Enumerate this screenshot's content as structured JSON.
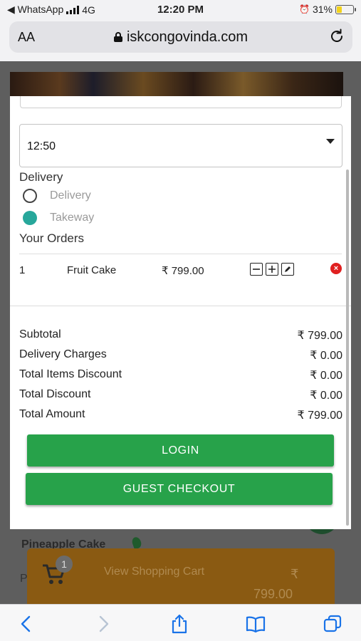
{
  "status_bar": {
    "back_app": "◀ WhatsApp",
    "network": "4G",
    "time": "12:20 PM",
    "battery": "31%",
    "battery_level": 0.31
  },
  "browser": {
    "text_size_label": "AA",
    "url": "iskcongovinda.com"
  },
  "modal": {
    "time_select": {
      "value": "12:50"
    },
    "delivery_section_title": "Delivery",
    "delivery_options": [
      {
        "label": "Delivery",
        "selected": false
      },
      {
        "label": "Takeway",
        "selected": true
      }
    ],
    "orders_title": "Your Orders",
    "orders": [
      {
        "qty": "1",
        "name": "Fruit Cake",
        "price": "₹ 799.00"
      }
    ],
    "summary": [
      {
        "label": "Subtotal",
        "value": "₹ 799.00"
      },
      {
        "label": "Delivery Charges",
        "value": "₹ 0.00"
      },
      {
        "label": "Total Items Discount",
        "value": "₹ 0.00"
      },
      {
        "label": "Total Discount",
        "value": "₹ 0.00"
      },
      {
        "label": "Total Amount",
        "value": "₹ 799.00"
      }
    ],
    "login_label": "LOGIN",
    "guest_checkout_label": "GUEST CHECKOUT"
  },
  "background_page": {
    "product_name": "Pineapple Cake",
    "row_letter": "P",
    "cart_count": "1",
    "cart_label": "View Shopping Cart",
    "cart_currency": "₹",
    "cart_total": "799.00"
  },
  "colors": {
    "accent_green": "#27a24a",
    "radio_teal": "#27a79b",
    "remove_red": "#e02020"
  }
}
